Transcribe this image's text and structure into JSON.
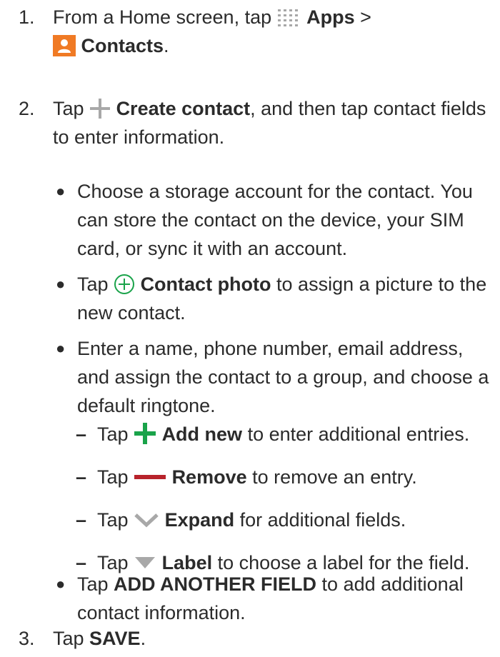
{
  "steps": [
    {
      "num": "1.",
      "pre": "From a Home screen, tap ",
      "apps": "Apps",
      "sep": " >",
      "contacts": "Contacts",
      "end": "."
    },
    {
      "num": "2.",
      "pre": "Tap ",
      "bold": "Create contact",
      "post": ", and then tap contact fields to enter information."
    },
    {
      "num": "3.",
      "pre": "Tap ",
      "bold": "SAVE",
      "post": "."
    }
  ],
  "bullets": [
    {
      "text": "Choose a storage account for the contact. You can store the contact on the device, your SIM card, or sync it with an account."
    },
    {
      "pre": "Tap ",
      "bold": "Contact photo",
      "post": " to assign a picture to the new contact."
    },
    {
      "text": "Enter a name, phone number, email address, and assign the contact to a group, and choose a default ringtone."
    },
    {
      "pre": "Tap ",
      "bold": "ADD ANOTHER FIELD",
      "post": " to add additional contact information."
    }
  ],
  "subs": [
    {
      "pre": "Tap ",
      "bold": "Add new",
      "post": " to enter additional entries."
    },
    {
      "pre": "Tap ",
      "bold": "Remove",
      "post": " to remove an entry."
    },
    {
      "pre": "Tap ",
      "bold": "Expand",
      "post": " for additional fields."
    },
    {
      "pre": "Tap ",
      "bold": "Label",
      "post": " to choose a label for the field."
    }
  ],
  "colors": {
    "text": "#2b2b2b",
    "contacts_icon_bg": "#f07a24",
    "add_green": "#1aa34a",
    "remove_red": "#b8232b",
    "grey_icon": "#a8a8a8"
  },
  "icons": {
    "apps": "apps-grid-icon",
    "contacts": "contacts-app-icon",
    "create": "plus-grey-icon",
    "photo": "circle-plus-icon",
    "add": "plus-green-icon",
    "remove": "minus-red-icon",
    "expand": "chevron-down-icon",
    "label": "triangle-down-icon"
  }
}
